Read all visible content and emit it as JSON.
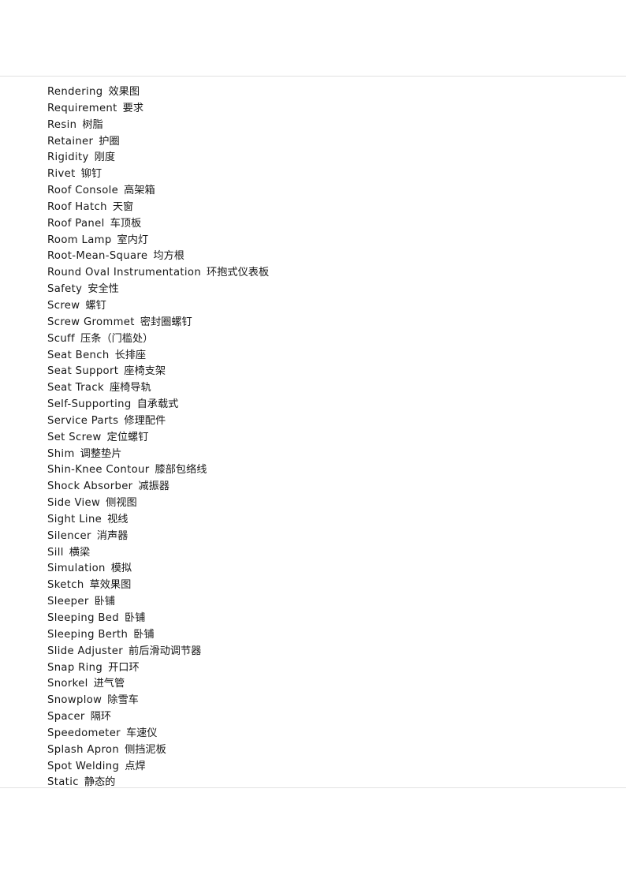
{
  "document": {
    "type": "glossary-page",
    "rules": {
      "top_divider": true,
      "bottom_divider": true,
      "color": "#e2e2e2"
    },
    "text_color": "#181818",
    "background_color": "#ffffff"
  },
  "glossary": {
    "entries": [
      {
        "en": "Rendering",
        "zh": "效果图"
      },
      {
        "en": "Requirement",
        "zh": "要求"
      },
      {
        "en": "Resin",
        "zh": "树脂"
      },
      {
        "en": "Retainer",
        "zh": "护圈"
      },
      {
        "en": "Rigidity",
        "zh": "刚度"
      },
      {
        "en": "Rivet",
        "zh": "铆钉"
      },
      {
        "en": "Roof Console",
        "zh": "高架箱"
      },
      {
        "en": "Roof Hatch",
        "zh": "天窗"
      },
      {
        "en": "Roof Panel",
        "zh": "车顶板"
      },
      {
        "en": "Room Lamp",
        "zh": "室内灯"
      },
      {
        "en": "Root-Mean-Square",
        "zh": "均方根"
      },
      {
        "en": "Round Oval Instrumentation",
        "zh": "环抱式仪表板"
      },
      {
        "en": "Safety",
        "zh": "安全性"
      },
      {
        "en": "Screw",
        "zh": "螺钉"
      },
      {
        "en": "Screw Grommet",
        "zh": "密封圈螺钉"
      },
      {
        "en": "Scuff",
        "zh": "压条（门槛处）"
      },
      {
        "en": "Seat Bench",
        "zh": "长排座"
      },
      {
        "en": "Seat Support",
        "zh": "座椅支架"
      },
      {
        "en": "Seat Track",
        "zh": "座椅导轨"
      },
      {
        "en": "Self-Supporting",
        "zh": "自承载式"
      },
      {
        "en": "Service Parts",
        "zh": "修理配件"
      },
      {
        "en": "Set Screw",
        "zh": "定位螺钉"
      },
      {
        "en": "Shim",
        "zh": "调整垫片"
      },
      {
        "en": "Shin-Knee Contour",
        "zh": "膝部包络线"
      },
      {
        "en": "Shock Absorber",
        "zh": "减振器"
      },
      {
        "en": "Side View",
        "zh": "侧视图"
      },
      {
        "en": "Sight Line",
        "zh": "视线"
      },
      {
        "en": "Silencer",
        "zh": "消声器"
      },
      {
        "en": "Sill",
        "zh": "横梁"
      },
      {
        "en": "Simulation",
        "zh": "模拟"
      },
      {
        "en": "Sketch",
        "zh": "草效果图"
      },
      {
        "en": "Sleeper",
        "zh": "卧铺"
      },
      {
        "en": "Sleeping Bed",
        "zh": "卧铺"
      },
      {
        "en": "Sleeping Berth",
        "zh": "卧铺"
      },
      {
        "en": "Slide Adjuster",
        "zh": "前后滑动调节器"
      },
      {
        "en": "Snap Ring",
        "zh": "开口环"
      },
      {
        "en": "Snorkel",
        "zh": "进气管"
      },
      {
        "en": "Snowplow",
        "zh": "除雪车"
      },
      {
        "en": "Spacer",
        "zh": "隔环"
      },
      {
        "en": "Speedometer",
        "zh": "车速仪"
      },
      {
        "en": "Splash Apron",
        "zh": "侧挡泥板"
      },
      {
        "en": "Spot Welding",
        "zh": "点焊"
      },
      {
        "en": "Static",
        "zh": "静态的"
      }
    ]
  }
}
